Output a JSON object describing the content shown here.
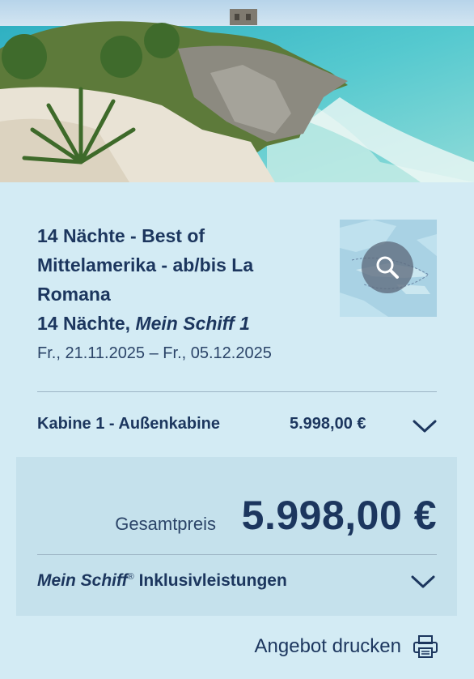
{
  "hero": {
    "image": "beach-with-ruins-photo"
  },
  "offer": {
    "title_lines": [
      "14 Nächte - Best of",
      "Mittelamerika - ab/bis La",
      "Romana"
    ],
    "duration": "14 Nächte,",
    "ship": "Mein Schiff 1",
    "dates": "Fr., 21.11.2025 – Fr., 05.12.2025"
  },
  "map": {
    "icon": "magnifier-icon"
  },
  "cabin": {
    "label": "Kabine 1 - Außenkabine",
    "price": "5.998,00 €",
    "icon": "chevron-down-icon"
  },
  "total": {
    "label": "Gesamtpreis",
    "price": "5.998,00 €"
  },
  "inclusive": {
    "brand": "Mein Schiff",
    "registered": "®",
    "label": "Inklusivleistungen",
    "icon": "chevron-down-icon"
  },
  "print": {
    "label": "Angebot drucken",
    "icon": "printer-icon"
  },
  "colors": {
    "text": "#1c365e",
    "panel": "#d3ebf4",
    "box": "#c5e1ec"
  }
}
